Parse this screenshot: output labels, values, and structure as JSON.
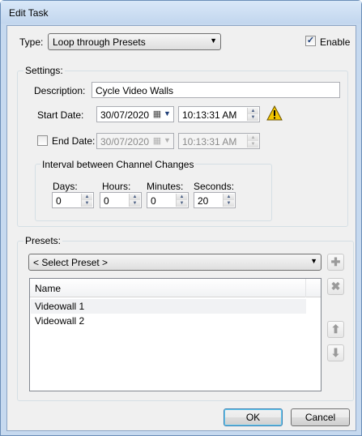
{
  "window": {
    "title": "Edit Task"
  },
  "type_row": {
    "label": "Type:",
    "selected": "Loop through Presets",
    "enable_label": "Enable",
    "enable_checked": true
  },
  "settings": {
    "group_label": "Settings:",
    "description_label": "Description:",
    "description_value": "Cycle Video Walls",
    "start_date_label": "Start Date:",
    "start_date_value": "30/07/2020",
    "start_time_value": "10:13:31 AM",
    "end_date_label": "End Date:",
    "end_date_checked": false,
    "end_date_value": "30/07/2020",
    "end_time_value": "10:13:31 AM",
    "interval": {
      "group_label": "Interval between Channel Changes",
      "days_label": "Days:",
      "days_value": "0",
      "hours_label": "Hours:",
      "hours_value": "0",
      "minutes_label": "Minutes:",
      "minutes_value": "0",
      "seconds_label": "Seconds:",
      "seconds_value": "20"
    }
  },
  "presets": {
    "group_label": "Presets:",
    "select_placeholder": "< Select Preset >",
    "column_name": "Name",
    "items": [
      "Videowall 1",
      "Videowall 2"
    ]
  },
  "footer": {
    "ok_label": "OK",
    "cancel_label": "Cancel"
  },
  "colors": {
    "window_frame": "#c6d9ef",
    "client_bg": "#f0f0f0",
    "warning": "#f2c500",
    "default_button_border": "#3c7fb1"
  },
  "icons": {
    "enable": "checkbox-checked-icon",
    "warning": "warning-triangle-icon",
    "add": "plus-icon",
    "remove": "close-icon",
    "move_up": "arrow-up-icon",
    "move_down": "arrow-down-icon"
  }
}
